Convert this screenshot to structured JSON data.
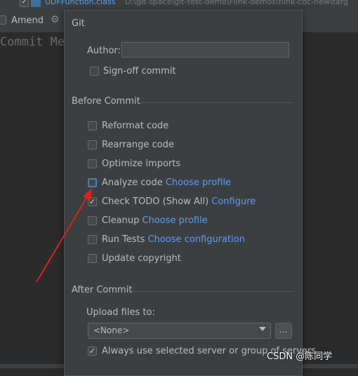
{
  "background": {
    "file_label": "UDFFunction.class",
    "file_path": "D:\\git-space\\git-test-demo\\Flink-demos\\flink-cdc-new\\targ",
    "amend_label": "Amend",
    "commit_placeholder": "Commit Me"
  },
  "panel": {
    "git_title": "Git",
    "author_label": "Author:",
    "author_value": "",
    "signoff_label": "Sign-off commit",
    "before_title": "Before Commit",
    "before_items": [
      {
        "label": "Reformat code",
        "link": "",
        "checked": false
      },
      {
        "label": "Rearrange code",
        "link": "",
        "checked": false
      },
      {
        "label": "Optimize imports",
        "link": "",
        "checked": false
      },
      {
        "label": "Analyze code",
        "link": "Choose profile",
        "checked": false
      },
      {
        "label": "Check TODO (Show All)",
        "link": "Configure",
        "checked": true
      },
      {
        "label": "Cleanup",
        "link": "Choose profile",
        "checked": false
      },
      {
        "label": "Run Tests",
        "link": "Choose configuration",
        "checked": false
      },
      {
        "label": "Update copyright",
        "link": "",
        "checked": false
      }
    ],
    "after_title": "After Commit",
    "upload_label": "Upload files to:",
    "upload_value": "<None>",
    "browse_label": "...",
    "always_use_label": "Always use selected server or group of servers"
  },
  "watermark": "CSDN @陈同学",
  "colors": {
    "link": "#589df6",
    "arrow": "#e02020",
    "panel_bg": "#3c3f41"
  }
}
